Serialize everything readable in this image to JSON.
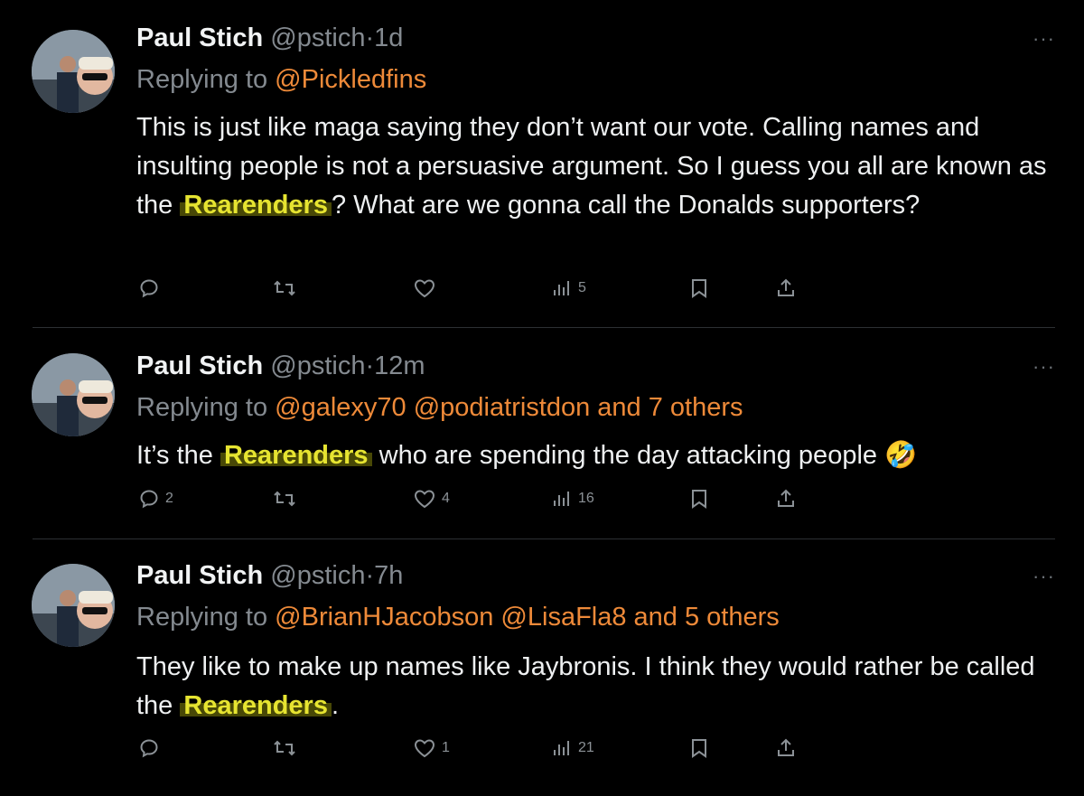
{
  "tweets": [
    {
      "name": "Paul Stich",
      "handle": "@pstich",
      "dot": "·",
      "time": "1d",
      "replying_prefix": "Replying to",
      "mentions": "@Pickledfins",
      "body_parts": [
        "This is just like maga saying they don’t want our vote. Calling names and insulting people is not a persuasive argument. So I guess you all are known as the ",
        "Rearenders",
        "? What are we gonna call the Donalds supporters?"
      ],
      "more": "···",
      "stats": {
        "replies": "",
        "retweets": "",
        "likes": "",
        "views": "5"
      }
    },
    {
      "name": "Paul Stich",
      "handle": "@pstich",
      "dot": "·",
      "time": "12m",
      "replying_prefix": "Replying to",
      "mentions": "@galexy70 @podiatristdon and 7 others",
      "body_parts": [
        "It’s the ",
        "Rearenders",
        " who are spending the day attacking people 🤣"
      ],
      "more": "···",
      "stats": {
        "replies": "2",
        "retweets": "",
        "likes": "4",
        "views": "16"
      }
    },
    {
      "name": "Paul Stich",
      "handle": "@pstich",
      "dot": "·",
      "time": "7h",
      "replying_prefix": "Replying to",
      "mentions": "@BrianHJacobson @LisaFla8 and 5 others",
      "body_parts": [
        "They like to make up names like Jaybronis. I think they would rather be called the ",
        "Rearenders",
        "."
      ],
      "more": "···",
      "stats": {
        "replies": "",
        "retweets": "",
        "likes": "1",
        "views": "21"
      }
    }
  ],
  "icons": [
    "reply-icon",
    "retweet-icon",
    "like-icon",
    "views-icon",
    "bookmark-icon",
    "share-icon"
  ],
  "colors": {
    "background": "#000000",
    "mention": "#ee8a39",
    "highlight_text": "#e6e431",
    "muted": "#848a90"
  }
}
